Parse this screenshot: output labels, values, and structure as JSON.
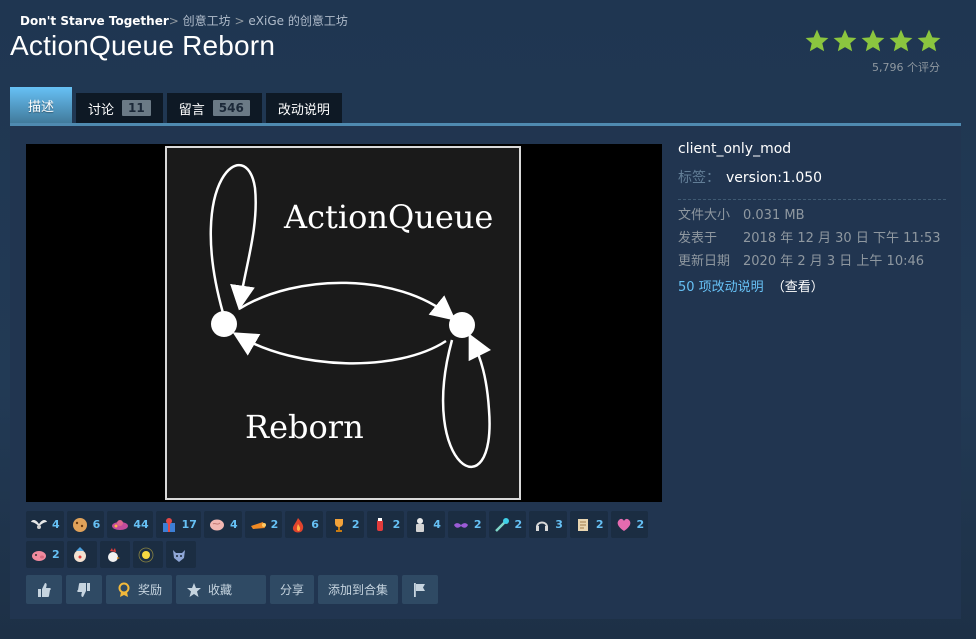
{
  "breadcrumb": {
    "game": "Don't Starve Together",
    "sep1": ">",
    "workshop": "创意工坊",
    "sep2": ">",
    "author": "eXiGe 的创意工坊"
  },
  "title": "ActionQueue Reborn",
  "rating": {
    "stars": 5,
    "of": 5,
    "count_text": "5,796 个评分",
    "star_color": "#8bc53f"
  },
  "tabs": [
    {
      "label": "描述",
      "active": true
    },
    {
      "label": "讨论",
      "count": "11"
    },
    {
      "label": "留言",
      "count": "546"
    },
    {
      "label": "改动说明"
    }
  ],
  "preview": {
    "title_line1": "ActionQueue",
    "title_line2": "Reborn"
  },
  "details": {
    "tag_top": "client_only_mod",
    "tags_label": "标签：",
    "tags_value": "version:1.050",
    "stats": [
      {
        "k": "文件大小",
        "v": "0.031 MB"
      },
      {
        "k": "发表于",
        "v": "2018 年 12 月 30 日 下午 11:53"
      },
      {
        "k": "更新日期",
        "v": "2020 年 2 月 3 日 上午 10:46"
      }
    ],
    "changes_link": "50 项改动说明",
    "view_link": "（查看）"
  },
  "awards": [
    {
      "icon": "wings-award-icon",
      "count": "4"
    },
    {
      "icon": "cookie-award-icon",
      "count": "6"
    },
    {
      "icon": "clover-award-icon",
      "count": "44"
    },
    {
      "icon": "gift-award-icon",
      "count": "17"
    },
    {
      "icon": "brain-award-icon",
      "count": "4"
    },
    {
      "icon": "horn-award-icon",
      "count": "2"
    },
    {
      "icon": "flame-award-icon",
      "count": "6"
    },
    {
      "icon": "trophy-award-icon",
      "count": "2"
    },
    {
      "icon": "potion-award-icon",
      "count": "2"
    },
    {
      "icon": "statue-award-icon",
      "count": "4"
    },
    {
      "icon": "mustache-award-icon",
      "count": "2"
    },
    {
      "icon": "comet-award-icon",
      "count": "2"
    },
    {
      "icon": "headphones-award-icon",
      "count": "3"
    },
    {
      "icon": "scroll-award-icon",
      "count": "2"
    },
    {
      "icon": "heart-award-icon",
      "count": "2"
    },
    {
      "icon": "pig-award-icon",
      "count": "2"
    },
    {
      "icon": "clown-award-icon",
      "count": ""
    },
    {
      "icon": "rooster-award-icon",
      "count": ""
    },
    {
      "icon": "sparkle-award-icon",
      "count": ""
    },
    {
      "icon": "wolf-award-icon",
      "count": ""
    }
  ],
  "actions": {
    "award": "奖励",
    "favorite": "收藏",
    "share": "分享",
    "add_to_collection": "添加到合集"
  }
}
